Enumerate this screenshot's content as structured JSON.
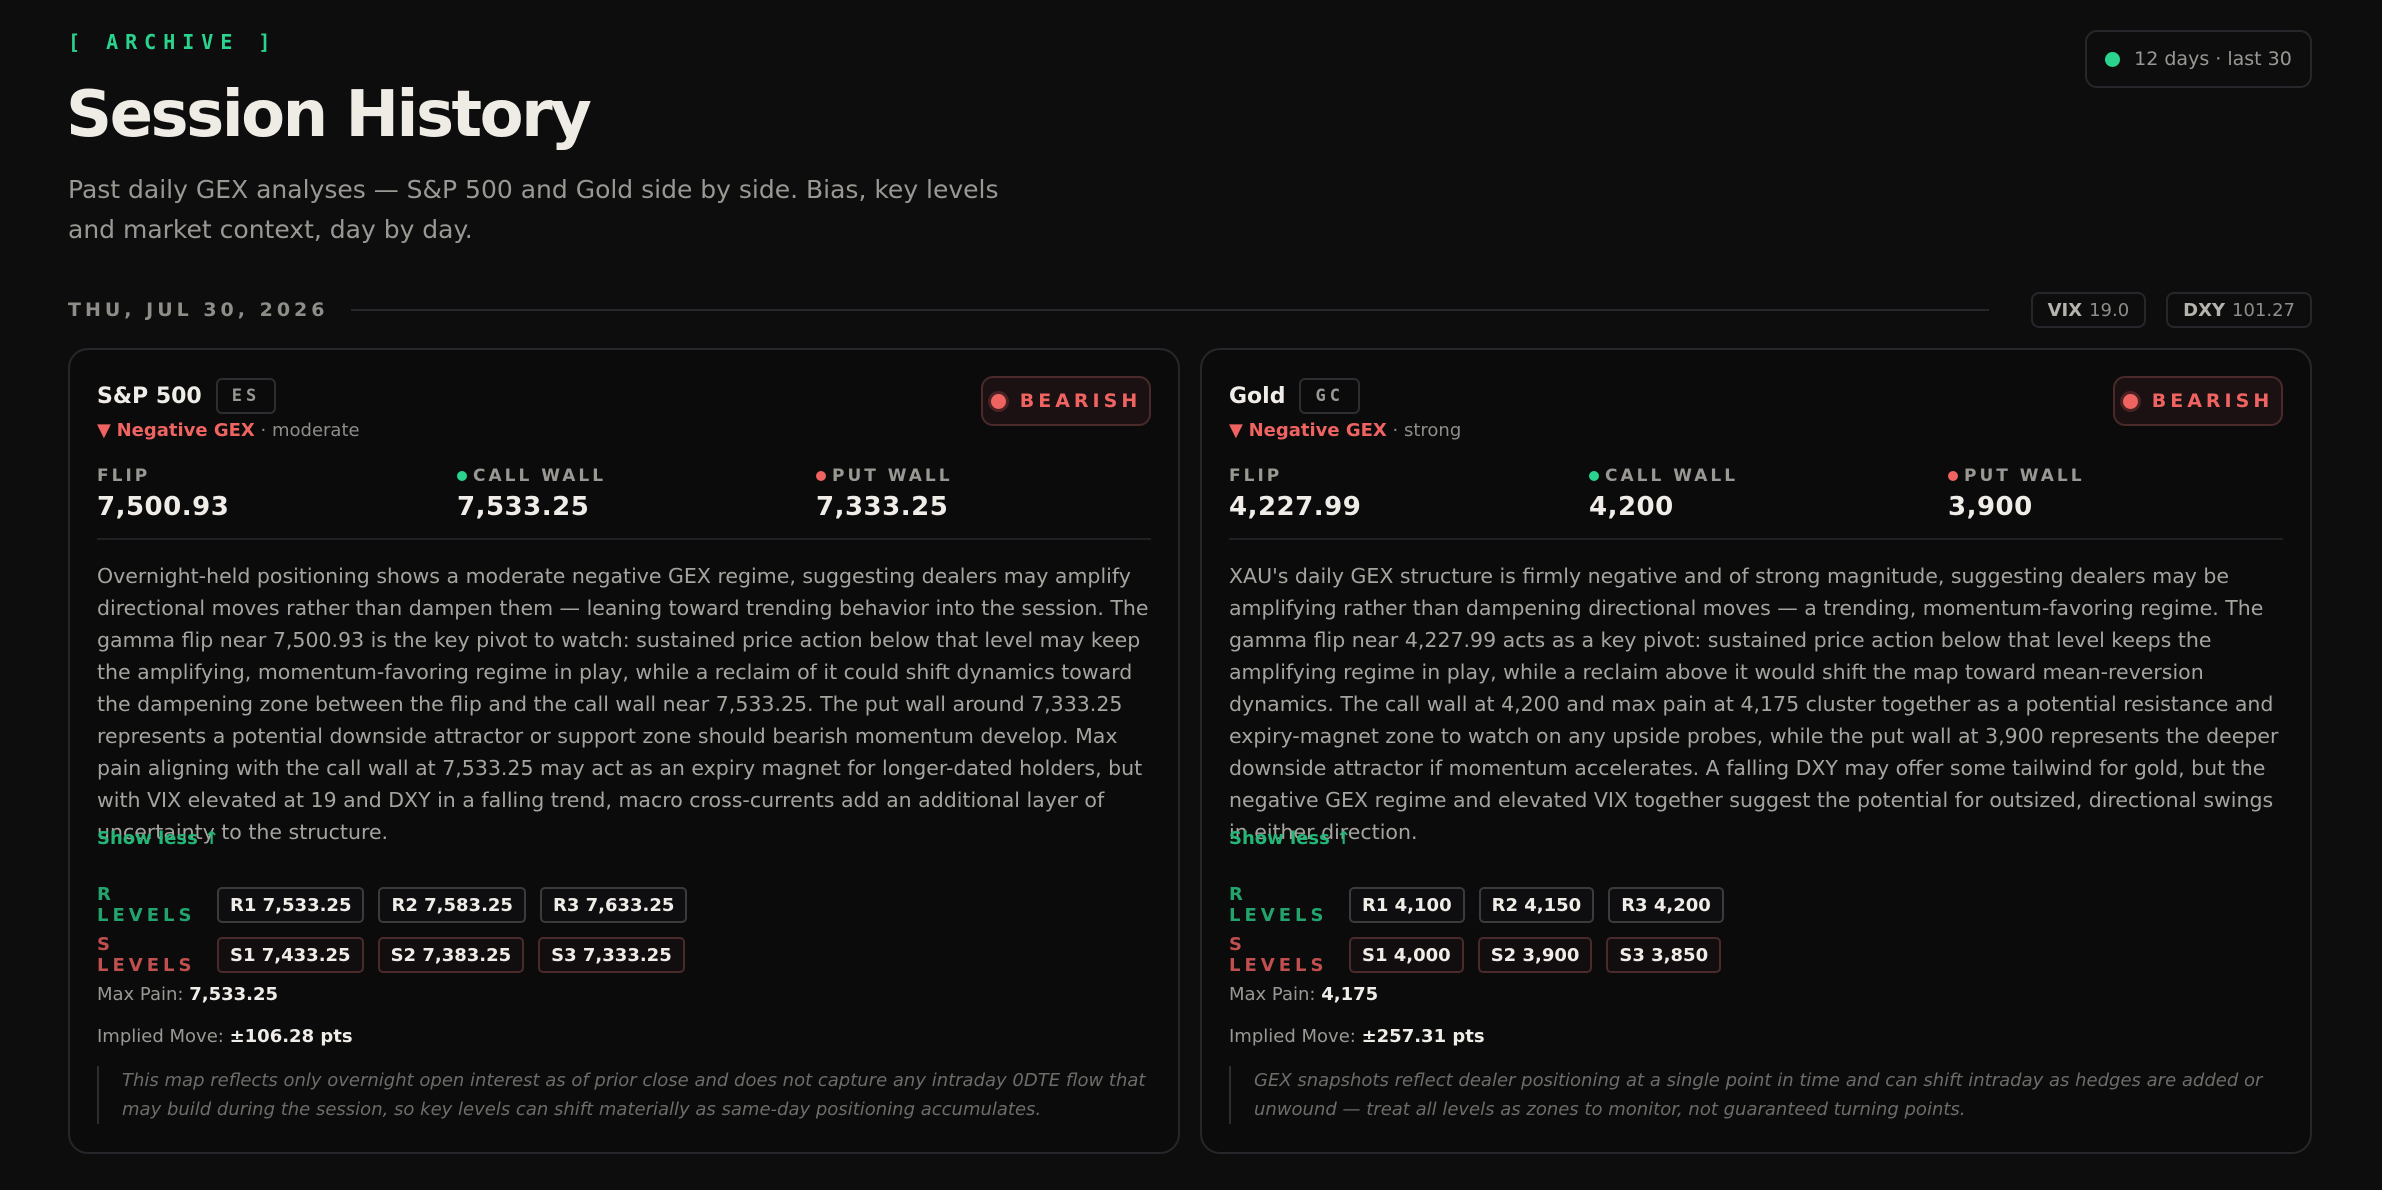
{
  "header": {
    "eyebrow": "[ ARCHIVE ]",
    "title": "Session History",
    "subtitle": "Past daily GEX analyses — S&P 500 and Gold side by side. Bias, key levels and market context, day by day.",
    "status": "12 days · last 30"
  },
  "session": {
    "date": "THU, JUL 30, 2026",
    "vix_label": "VIX",
    "vix_value": "19.0",
    "dxy_label": "DXY",
    "dxy_value": "101.27"
  },
  "labels": {
    "flip": "FLIP",
    "call_wall": "CALL WALL",
    "put_wall": "PUT WALL",
    "r_levels": "R LEVELS",
    "s_levels": "S LEVELS",
    "max_pain": "Max Pain:",
    "implied_move": "Implied Move:",
    "show_less": "Show less ↑"
  },
  "cards": [
    {
      "name": "S&P 500",
      "ticker": "ES",
      "regime_arrow": "▼",
      "regime": "Negative GEX",
      "strength": " · moderate",
      "bias": "BEARISH",
      "flip": "7,500.93",
      "call_wall": "7,533.25",
      "put_wall": "7,333.25",
      "analysis": "Overnight-held positioning shows a moderate negative GEX regime, suggesting dealers may amplify directional moves rather than dampen them — leaning toward trending behavior into the session. The gamma flip near 7,500.93 is the key pivot to watch: sustained price action below that level may keep the amplifying, momentum-favoring regime in play, while a reclaim of it could shift dynamics toward the dampening zone between the flip and the call wall near 7,533.25. The put wall around 7,333.25 represents a potential downside attractor or support zone should bearish momentum develop. Max pain aligning with the call wall at 7,533.25 may act as an expiry magnet for longer-dated holders, but with VIX elevated at 19 and DXY in a falling trend, macro cross-currents add an additional layer of uncertainty to the structure.",
      "r_levels": [
        "R1 7,533.25",
        "R2 7,583.25",
        "R3 7,633.25"
      ],
      "s_levels": [
        "S1 7,433.25",
        "S2 7,383.25",
        "S3 7,333.25"
      ],
      "max_pain": "7,533.25",
      "implied_move": "±106.28 pts",
      "disclaimer": "This map reflects only overnight open interest as of prior close and does not capture any intraday 0DTE flow that may build during the session, so key levels can shift materially as same-day positioning accumulates."
    },
    {
      "name": "Gold",
      "ticker": "GC",
      "regime_arrow": "▼",
      "regime": "Negative GEX",
      "strength": " · strong",
      "bias": "BEARISH",
      "flip": "4,227.99",
      "call_wall": "4,200",
      "put_wall": "3,900",
      "analysis": "XAU's daily GEX structure is firmly negative and of strong magnitude, suggesting dealers may be amplifying rather than dampening directional moves — a trending, momentum-favoring regime. The gamma flip near 4,227.99 acts as a key pivot: sustained price action below that level keeps the amplifying regime in play, while a reclaim above it would shift the map toward mean-reversion dynamics. The call wall at 4,200 and max pain at 4,175 cluster together as a potential resistance and expiry-magnet zone to watch on any upside probes, while the put wall at 3,900 represents the deeper downside attractor if momentum accelerates. A falling DXY may offer some tailwind for gold, but the negative GEX regime and elevated VIX together suggest the potential for outsized, directional swings in either direction.",
      "r_levels": [
        "R1 4,100",
        "R2 4,150",
        "R3 4,200"
      ],
      "s_levels": [
        "S1 4,000",
        "S2 3,900",
        "S3 3,850"
      ],
      "max_pain": "4,175",
      "implied_move": "±257.31 pts",
      "disclaimer": "GEX snapshots reflect dealer positioning at a single point in time and can shift intraday as hedges are added or unwound — treat all levels as zones to monitor, not guaranteed turning points."
    }
  ],
  "colors": {
    "accent_green": "#2ad48e",
    "bearish_red": "#ef6461",
    "background": "#0d0d0e"
  },
  "icons": {
    "status": "status-dot",
    "bias": "bias-dot",
    "call_wall": "green-dot",
    "put_wall": "red-dot",
    "regime": "down-triangle"
  }
}
